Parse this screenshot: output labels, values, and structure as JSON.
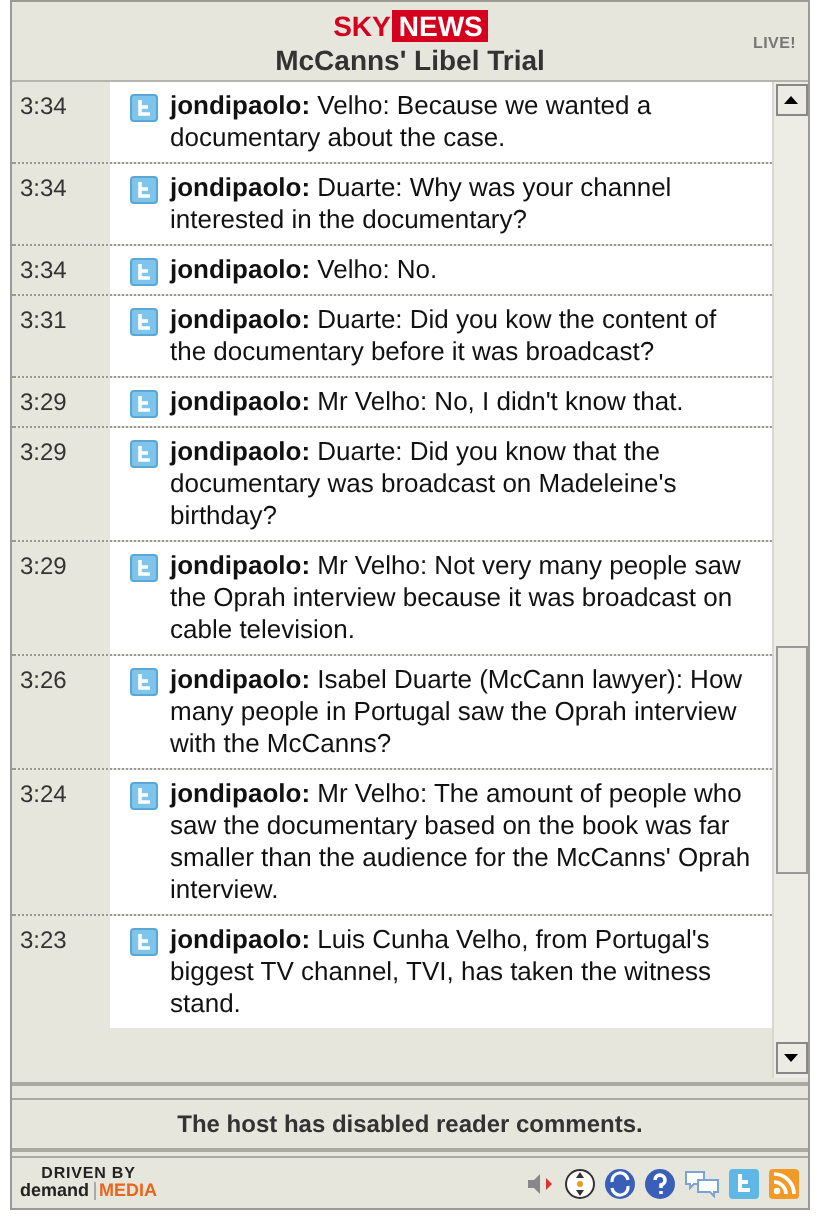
{
  "header": {
    "logo": {
      "part_1": "SKY",
      "part_2": "NEWS"
    },
    "title": "McCanns' Libel Trial",
    "badge": "LIVE!"
  },
  "entries": [
    {
      "time": "3:34",
      "text": "**jondipaolo:** Velho: Because we wanted a documentary about the case."
    },
    {
      "time": "3:34",
      "text": "**jondipaolo:** Duarte: Why was your channel interested in the documentary?"
    },
    {
      "time": "3:34",
      "text": "**jondipaolo:** Velho: No."
    },
    {
      "time": "3:31",
      "text": "**jondipaolo:** Duarte: Did you kow the content of the documentary before it was broadcast?"
    },
    {
      "time": "3:29",
      "text": "**jondipaolo:** Mr Velho: No, I didn't know that."
    },
    {
      "time": "3:29",
      "text": "**jondipaolo:** Duarte: Did you know that the documentary was broadcast on Madeleine's birthday?"
    },
    {
      "time": "3:29",
      "text": "**jondipaolo:** Mr Velho: Not very many people saw the Oprah interview because it was broadcast on cable television."
    },
    {
      "time": "3:26",
      "text": "**jondipaolo:** Isabel Duarte (McCann lawyer): How many people in Portugal saw the Oprah interview with the McCanns?"
    },
    {
      "time": "3:24",
      "text": "**jondipaolo:** Mr Velho: The amount of people who saw the documentary based on the book was far smaller than the audience for the McCanns' Oprah interview."
    },
    {
      "time": "3:23",
      "text": "**jondipaolo:** Luis Cunha Velho, from Portugal's biggest TV channel, TVI, has taken the witness stand."
    }
  ],
  "comments_notice": "The host has disabled reader comments.",
  "footer": {
    "brand_line_1": "DRIVEN BY",
    "brand_word_1": "demand",
    "brand_word_2": "MEDIA"
  }
}
